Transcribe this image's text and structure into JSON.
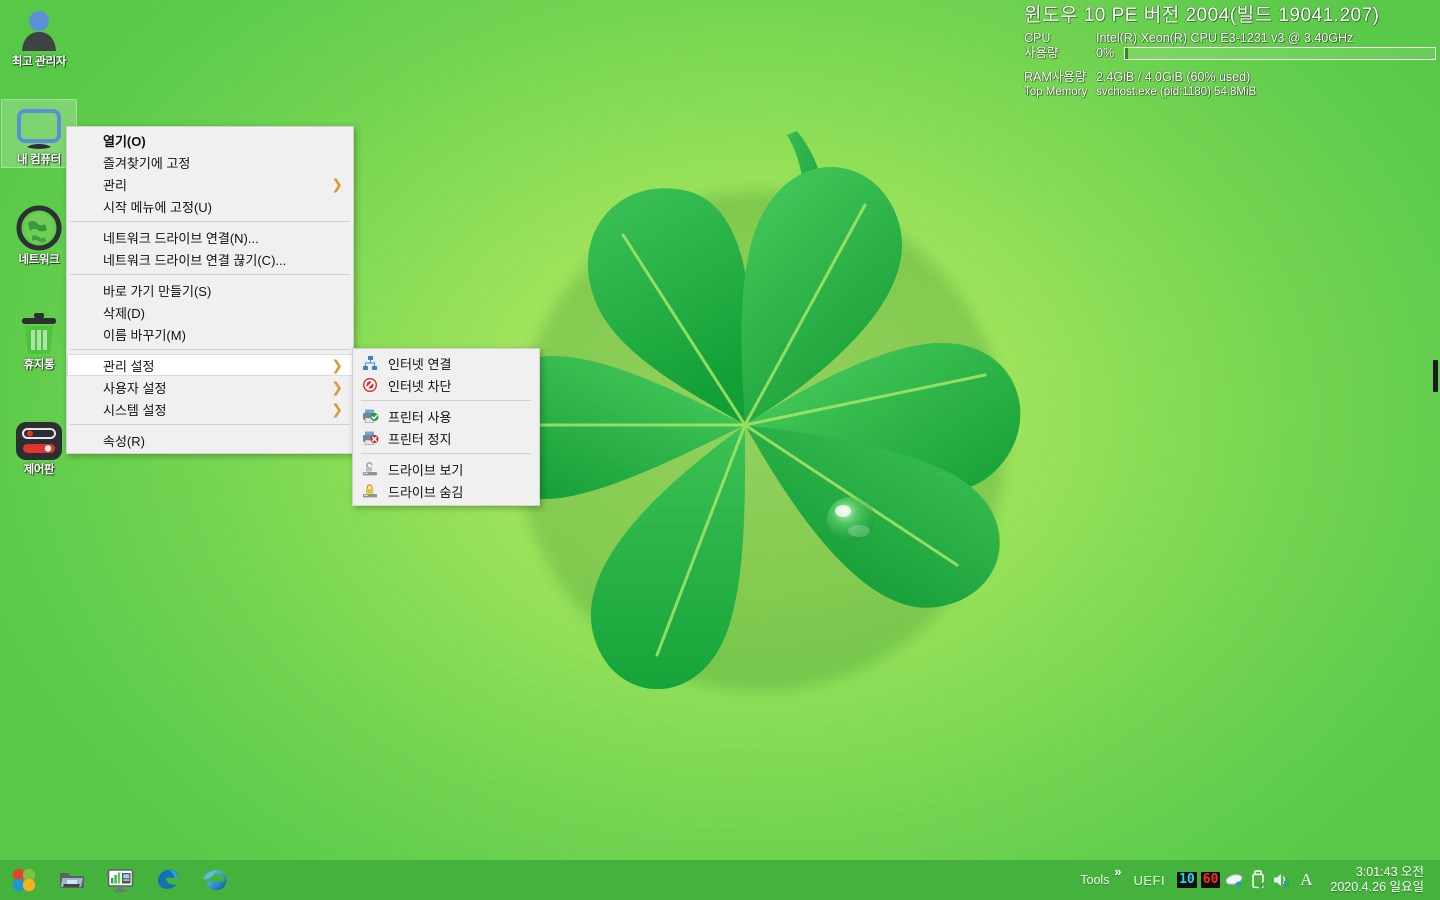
{
  "wallpaper": {
    "bg_center": "#b6ec6e",
    "bg_edge": "#58c948",
    "leaf_dark": "#16a33a",
    "leaf_light": "#3fc24a",
    "vein": "#a8e86a"
  },
  "sysinfo": {
    "os_line": "윈도우 10 PE   버전 2004(빌드 19041.207)",
    "cpu_label": "CPU",
    "cpu_value": "Intel(R) Xeon(R) CPU E3-1231 v3 @ 3.40GHz",
    "cpu_usage_label": "사용량",
    "cpu_usage_pct": "0%",
    "cpu_usage_value": 0,
    "ram_label": "RAM사용량",
    "ram_value": "2.4GiB / 4.0GiB (60% used)",
    "topmem_label": "Top Memory",
    "topmem_value": "svchost.exe (pid:1180) 54.8MiB"
  },
  "desktop_icons": [
    {
      "name": "admin",
      "label": "최고 관리자",
      "icon": "user-icon",
      "selected": false
    },
    {
      "name": "my-computer",
      "label": "내 컴퓨터",
      "icon": "monitor-icon",
      "selected": true
    },
    {
      "name": "network",
      "label": "네트워크",
      "icon": "globe-icon",
      "selected": false
    },
    {
      "name": "recycle-bin",
      "label": "휴지통",
      "icon": "trash-icon",
      "selected": false
    },
    {
      "name": "control-panel",
      "label": "제어판",
      "icon": "control-panel-icon",
      "selected": false
    }
  ],
  "context_menu": {
    "items": [
      {
        "label": "열기(O)",
        "bold": true,
        "arrow": false,
        "active": false,
        "sep_after": false
      },
      {
        "label": "즐겨찾기에 고정",
        "bold": false,
        "arrow": false,
        "active": false,
        "sep_after": false
      },
      {
        "label": "관리",
        "bold": false,
        "arrow": true,
        "active": false,
        "sep_after": false
      },
      {
        "label": "시작 메뉴에 고정(U)",
        "bold": false,
        "arrow": false,
        "active": false,
        "sep_after": true
      },
      {
        "label": "네트워크 드라이브 연결(N)...",
        "bold": false,
        "arrow": false,
        "active": false,
        "sep_after": false
      },
      {
        "label": "네트워크 드라이브 연결 끊기(C)...",
        "bold": false,
        "arrow": false,
        "active": false,
        "sep_after": true
      },
      {
        "label": "바로 가기 만들기(S)",
        "bold": false,
        "arrow": false,
        "active": false,
        "sep_after": false
      },
      {
        "label": "삭제(D)",
        "bold": false,
        "arrow": false,
        "active": false,
        "sep_after": false
      },
      {
        "label": "이름 바꾸기(M)",
        "bold": false,
        "arrow": false,
        "active": false,
        "sep_after": true
      },
      {
        "label": "관리 설정",
        "bold": false,
        "arrow": true,
        "active": true,
        "sep_after": false
      },
      {
        "label": "사용자 설정",
        "bold": false,
        "arrow": true,
        "active": false,
        "sep_after": false
      },
      {
        "label": "시스템 설정",
        "bold": false,
        "arrow": true,
        "active": false,
        "sep_after": true
      },
      {
        "label": "속성(R)",
        "bold": false,
        "arrow": false,
        "active": false,
        "sep_after": false
      }
    ],
    "arrow_glyph": "❯",
    "arrow_color": "#d79a3b"
  },
  "submenu": {
    "items": [
      {
        "label": "인터넷 연결",
        "icon": "network-node-icon",
        "sep_after": false
      },
      {
        "label": "인터넷 차단",
        "icon": "block-icon",
        "sep_after": true
      },
      {
        "label": "프린터 사용",
        "icon": "printer-enable-icon",
        "sep_after": false
      },
      {
        "label": "프린터 정지",
        "icon": "printer-stop-icon",
        "sep_after": true
      },
      {
        "label": "드라이브 보기",
        "icon": "drive-unlock-icon",
        "sep_after": false
      },
      {
        "label": "드라이브 숨김",
        "icon": "drive-lock-icon",
        "sep_after": false
      }
    ]
  },
  "taskbar": {
    "bg": "#44b23c",
    "buttons": [
      {
        "name": "start-button",
        "icon": "start-flower-icon"
      },
      {
        "name": "file-explorer-button",
        "icon": "folder-icon"
      },
      {
        "name": "task-manager-button",
        "icon": "monitor-chart-icon"
      },
      {
        "name": "edge-legacy-button",
        "icon": "edge-icon"
      },
      {
        "name": "internet-explorer-button",
        "icon": "ie-icon"
      }
    ],
    "tray": {
      "tools_label": "Tools",
      "overflow_glyph": "»",
      "uefi_label": "UEFI",
      "lcd_cyan": "10",
      "lcd_red": "60",
      "icons": [
        {
          "name": "mouse-icon"
        },
        {
          "name": "usb-drive-icon"
        },
        {
          "name": "volume-icon"
        }
      ],
      "ime_label": "A"
    },
    "clock": {
      "time": "3:01:43 오전",
      "date": "2020.4.26 일요일"
    }
  }
}
